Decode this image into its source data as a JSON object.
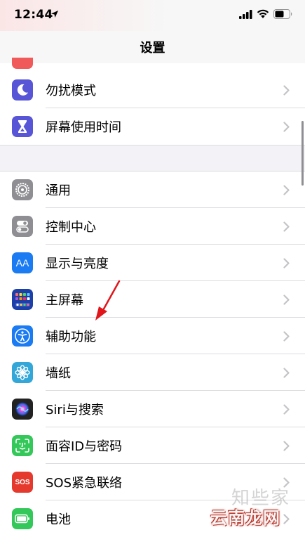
{
  "status_bar": {
    "time": "12:44"
  },
  "nav": {
    "title": "设置"
  },
  "group1": [
    {
      "label": "勿扰模式",
      "icon": "moon-icon",
      "color": "#5856d6"
    },
    {
      "label": "屏幕使用时间",
      "icon": "hourglass-icon",
      "color": "#5856d6"
    }
  ],
  "group2": [
    {
      "label": "通用",
      "icon": "gear-icon",
      "color": "#8e8e93"
    },
    {
      "label": "控制中心",
      "icon": "toggles-icon",
      "color": "#8e8e93"
    },
    {
      "label": "显示与亮度",
      "icon": "aa-icon",
      "icon_text": "AA",
      "color": "#1a7bf2"
    },
    {
      "label": "主屏幕",
      "icon": "home-screen-icon",
      "color": "#1c3fa8"
    },
    {
      "label": "辅助功能",
      "icon": "accessibility-icon",
      "color": "#1a7bf2"
    },
    {
      "label": "墙纸",
      "icon": "flower-icon",
      "color": "#34a7d9"
    },
    {
      "label": "Siri与搜索",
      "icon": "siri-icon",
      "color": "#222222"
    },
    {
      "label": "面容ID与密码",
      "icon": "face-id-icon",
      "color": "#34c759"
    },
    {
      "label": "SOS紧急联络",
      "icon": "sos-icon",
      "icon_text": "SOS",
      "color": "#e5392e"
    },
    {
      "label": "电池",
      "icon": "battery-icon",
      "color": "#34c759"
    }
  ],
  "watermark": {
    "line1": "知些家",
    "line2": "云南龙网"
  }
}
